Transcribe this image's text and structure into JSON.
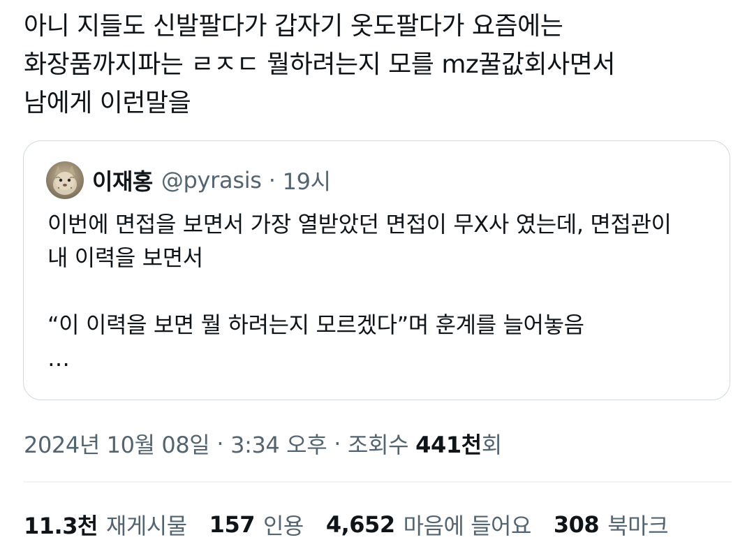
{
  "tweet": {
    "text": "아니 지들도 신발팔다가 갑자기 옷도팔다가 요즘에는\n화장품까지파는 ㄹㅈㄷ 뭘하려는지 모를 mz꿀값회사면서\n남에게 이런말을"
  },
  "quote": {
    "display_name": "이재홍",
    "handle": "@pyrasis",
    "separator": "·",
    "time": "19시",
    "body": "이번에 면접을 보면서 가장 열받았던 면접이 무X사 였는데, 면접관이\n내 이력을 보면서\n\n“이 이력을 보면 뭘 하려는지 모르겠다”며 훈계를 늘어놓음\n…",
    "avatar_icon": "cat-avatar-icon"
  },
  "meta": {
    "date": "2024년 10월 08일",
    "separator": "·",
    "time": "3:34 오후",
    "views_label": "조회수",
    "views_count": "441천",
    "views_suffix": "회"
  },
  "stats": [
    {
      "count": "11.3천",
      "label": "재게시물"
    },
    {
      "count": "157",
      "label": "인용"
    },
    {
      "count": "4,652",
      "label": "마음에 들어요"
    },
    {
      "count": "308",
      "label": "북마크"
    }
  ],
  "colors": {
    "text_primary": "#0f1419",
    "text_secondary": "#536471",
    "border": "#cfd9de",
    "divider": "#eff3f4"
  }
}
